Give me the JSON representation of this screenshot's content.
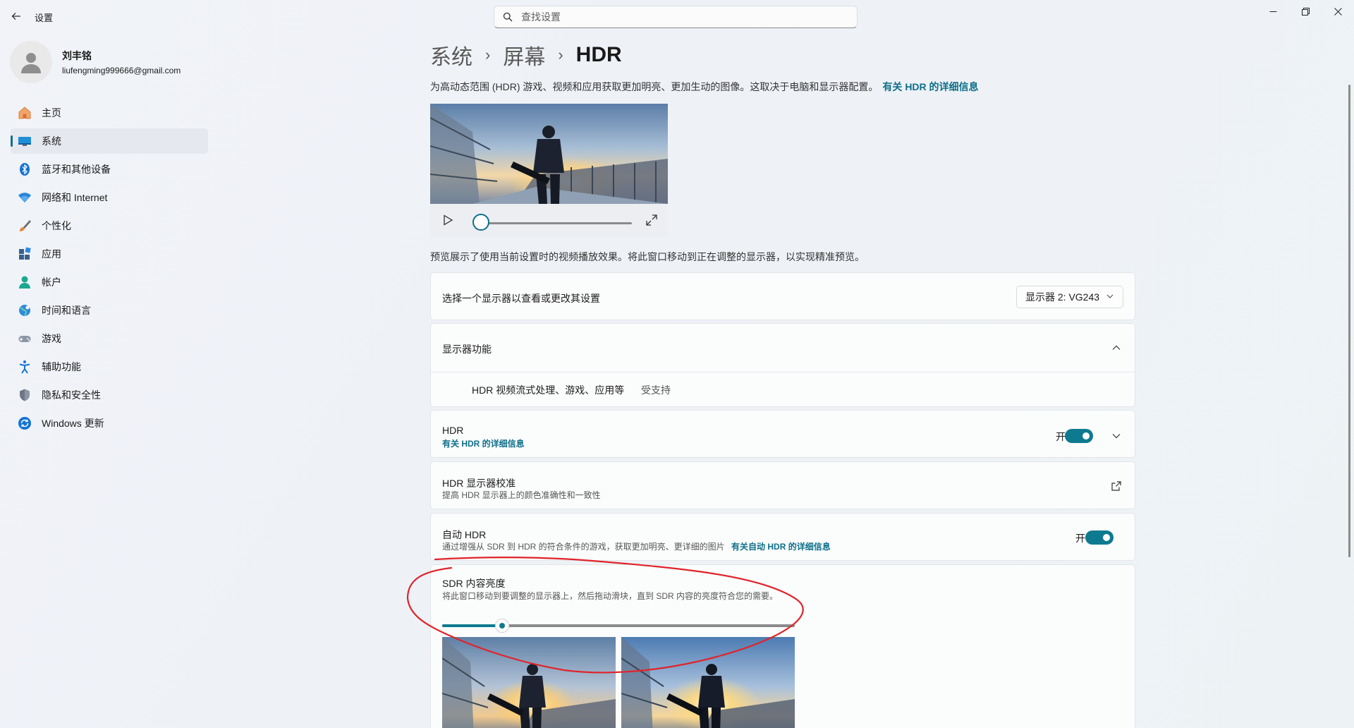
{
  "window": {
    "app_title": "设置",
    "back_icon": "back-arrow-icon",
    "minimize_icon": "minimize-icon",
    "maximize_icon": "restore-icon",
    "close_icon": "close-icon"
  },
  "search": {
    "placeholder": "查找设置",
    "value": ""
  },
  "profile": {
    "name": "刘丰铭",
    "email": "liufengming999666@gmail.com"
  },
  "sidebar": {
    "items": [
      {
        "label": "主页",
        "icon": "home-icon",
        "active": false
      },
      {
        "label": "系统",
        "icon": "system-icon",
        "active": true
      },
      {
        "label": "蓝牙和其他设备",
        "icon": "bluetooth-icon",
        "active": false
      },
      {
        "label": "网络和 Internet",
        "icon": "wifi-icon",
        "active": false
      },
      {
        "label": "个性化",
        "icon": "brush-icon",
        "active": false
      },
      {
        "label": "应用",
        "icon": "apps-icon",
        "active": false
      },
      {
        "label": "帐户",
        "icon": "account-icon",
        "active": false
      },
      {
        "label": "时间和语言",
        "icon": "globe-icon",
        "active": false
      },
      {
        "label": "游戏",
        "icon": "gamepad-icon",
        "active": false
      },
      {
        "label": "辅助功能",
        "icon": "accessibility-icon",
        "active": false
      },
      {
        "label": "隐私和安全性",
        "icon": "shield-icon",
        "active": false
      },
      {
        "label": "Windows 更新",
        "icon": "update-icon",
        "active": false
      }
    ]
  },
  "breadcrumb": {
    "level1": "系统",
    "level2": "屏幕",
    "level3": "HDR",
    "separator": "›"
  },
  "intro": {
    "text": "为高动态范围 (HDR) 游戏、视频和应用获取更加明亮、更加生动的图像。这取决于电脑和显示器配置。",
    "link": "有关 HDR 的详细信息"
  },
  "player": {
    "progress": 0
  },
  "preview_note": "预览展示了使用当前设置时的视频播放效果。将此窗口移动到正在调整的显示器，以实现精准预览。",
  "display_select": {
    "label": "选择一个显示器以查看或更改其设置",
    "selected": "显示器 2: VG243"
  },
  "capabilities": {
    "title": "显示器功能",
    "item_label": "HDR 视频流式处理、游戏、应用等",
    "item_status": "受支持"
  },
  "hdr": {
    "title": "HDR",
    "link": "有关 HDR 的详细信息",
    "state": "开",
    "on": true
  },
  "calibration": {
    "title": "HDR 显示器校准",
    "subtitle": "提高 HDR 显示器上的颜色准确性和一致性"
  },
  "auto_hdr": {
    "title": "自动 HDR",
    "subtitle": "通过增强从 SDR 到 HDR 的符合条件的游戏，获取更加明亮、更详细的图片",
    "link": "有关自动 HDR 的详细信息",
    "state": "开",
    "on": true
  },
  "sdr_brightness": {
    "title": "SDR 内容亮度",
    "subtitle": "将此窗口移动到要调整的显示器上，然后拖动滑块，直到 SDR 内容的亮度符合您的需要。",
    "value_fraction": 0.17
  },
  "colors": {
    "accent": "#0e7a8f",
    "link": "#0e6f8a",
    "annotation": "#e0242a"
  }
}
